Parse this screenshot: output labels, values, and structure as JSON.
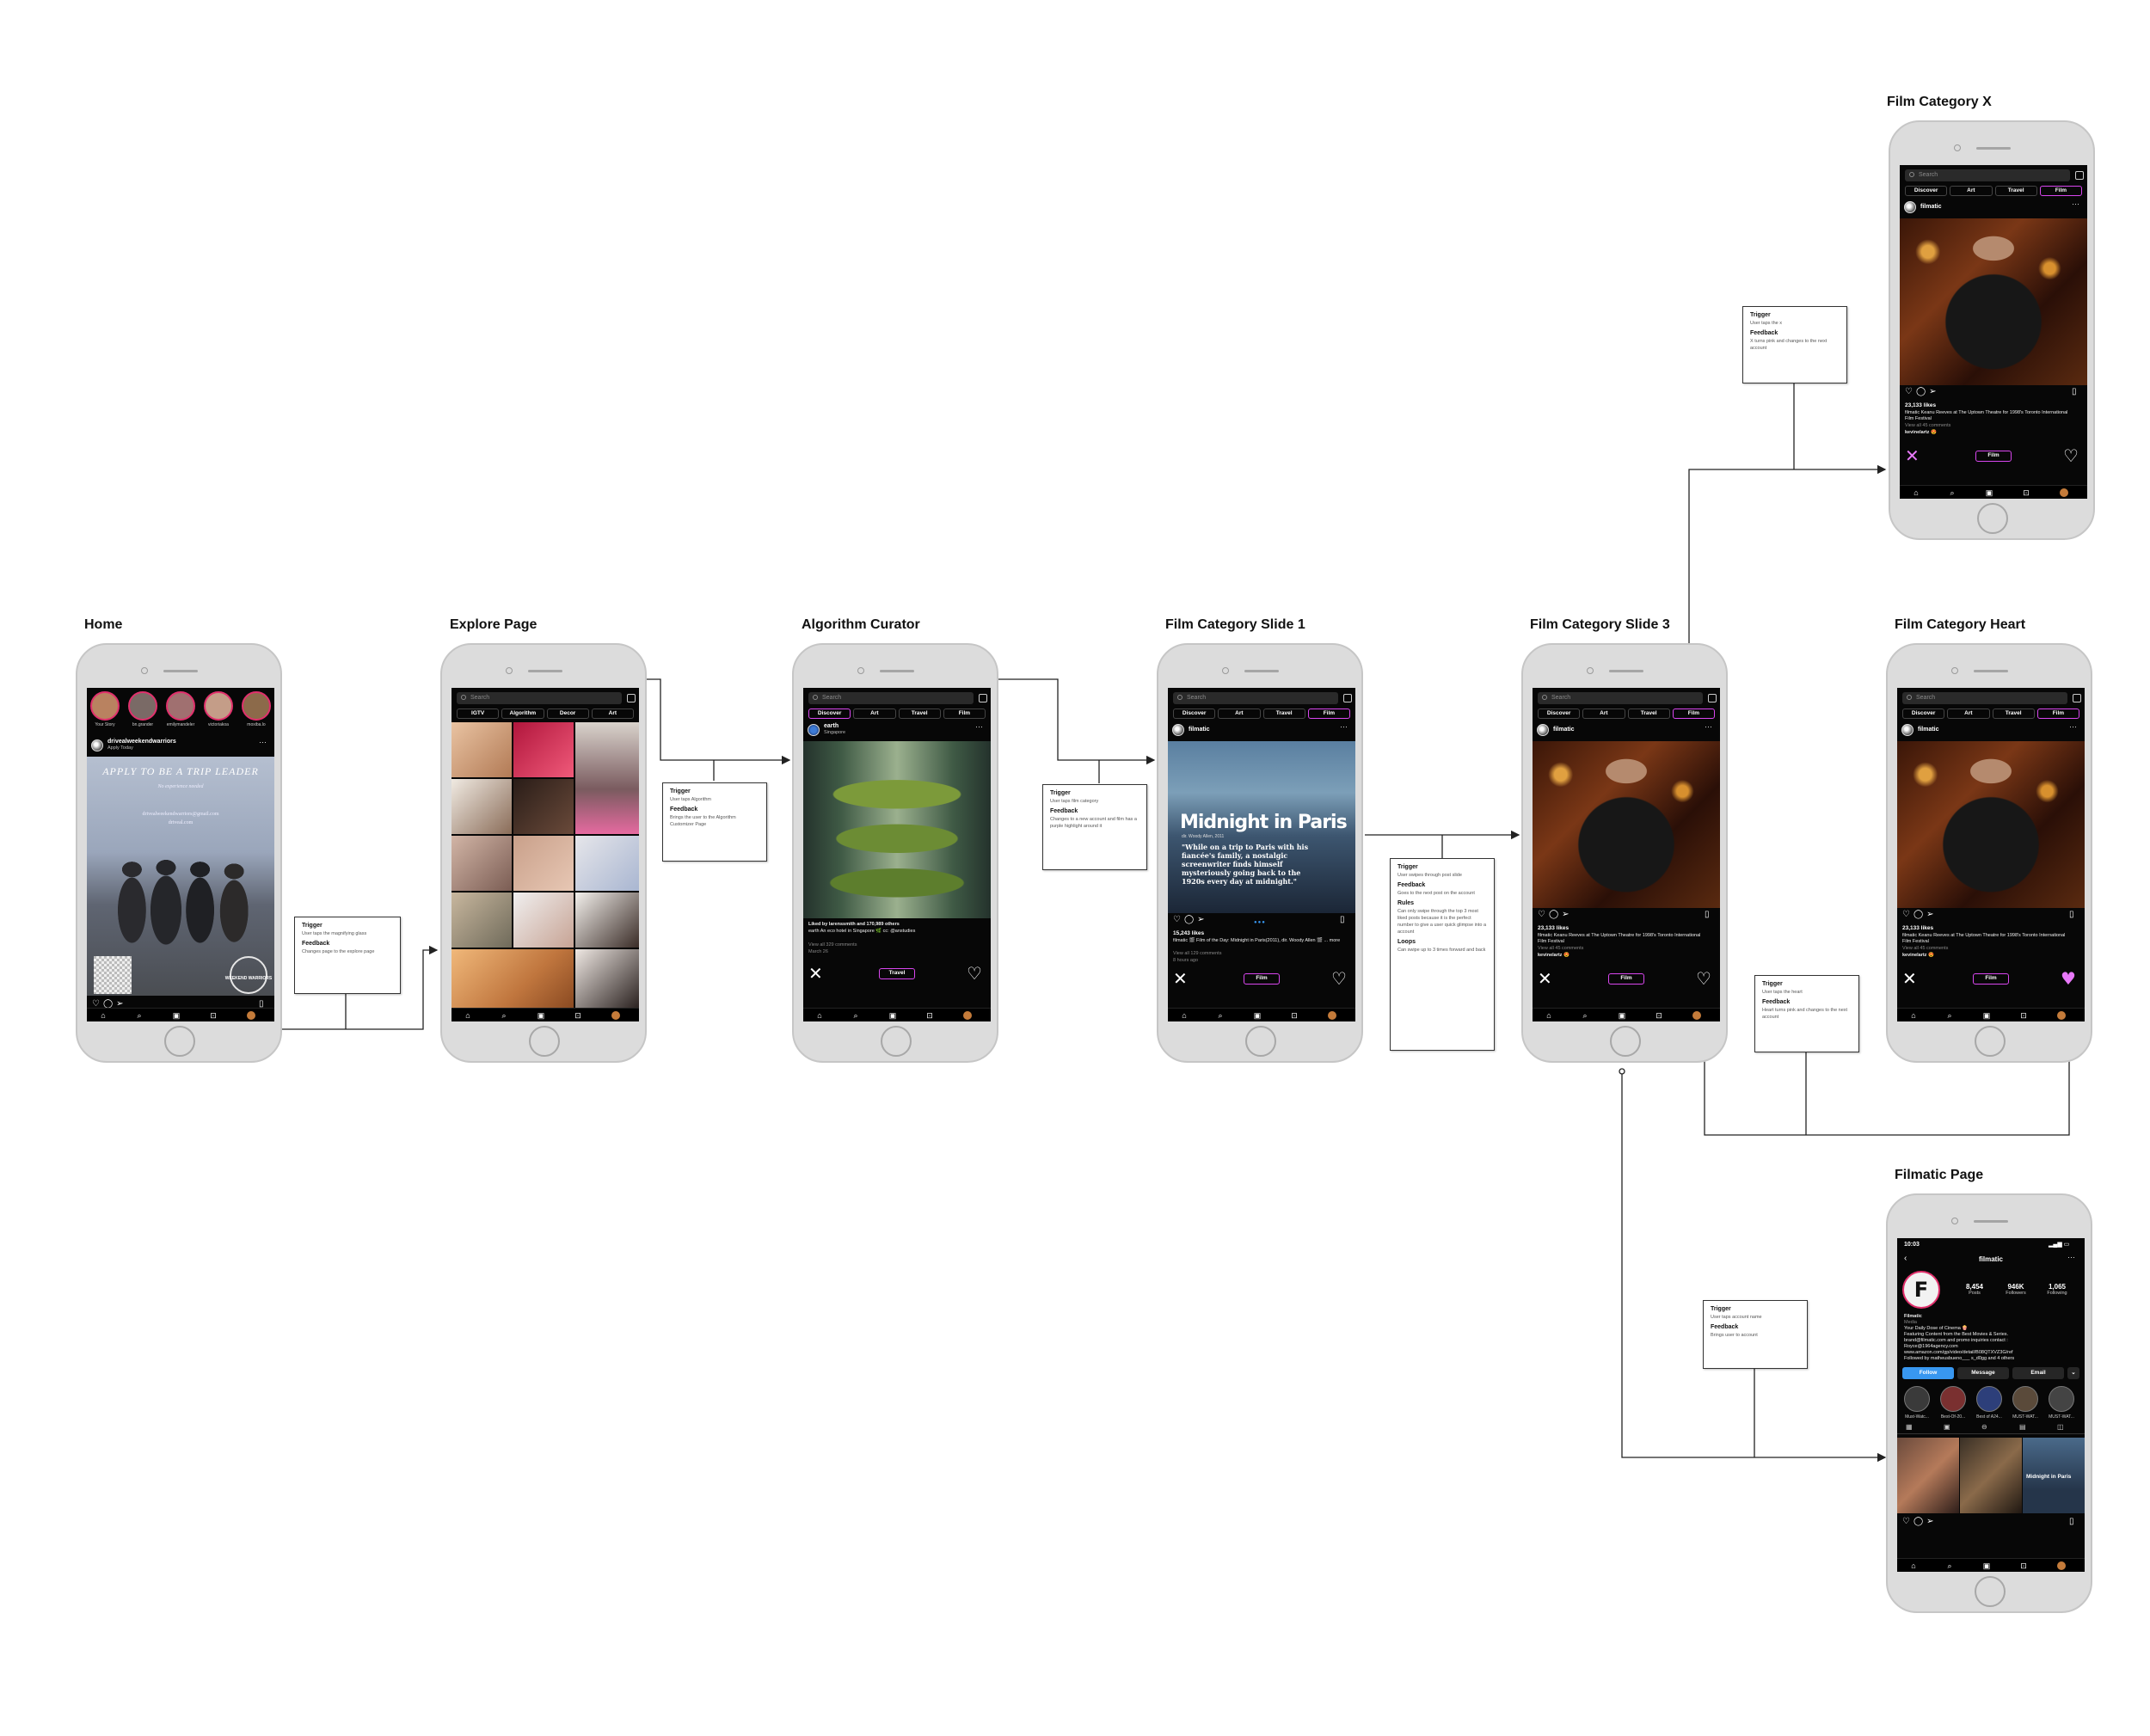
{
  "screens": {
    "home": {
      "title": "Home",
      "stories": [
        "Your Story",
        "bn.grander",
        "emilymandeler",
        "victoriakoa",
        "moxiba.lo"
      ],
      "account": "drivealweekendwarriors",
      "account_sub": "Apply Today",
      "poster_title": "APPLY TO BE A TRIP LEADER",
      "poster_line1": "No experience needed",
      "poster_line2": "drivealweekendwarriors@gmail.com",
      "poster_line3": "driveal.com",
      "badge": "WEEKEND WARRIORS"
    },
    "explore": {
      "title": "Explore Page",
      "search_placeholder": "Search",
      "tabs": [
        "IGTV",
        "Algorithm",
        "Decor",
        "Art"
      ]
    },
    "algorithm": {
      "title": "Algorithm Curator",
      "search_placeholder": "Search",
      "tabs": [
        "Discover",
        "Art",
        "Travel",
        "Film"
      ],
      "account": "earth",
      "account_sub": "Singapore",
      "caption": "Liked by larenssmith and 170,989 others",
      "caption2": "earth An eco hotel in Singapore 🌿 cc: @anstudies",
      "comments": "View all 329 comments",
      "date": "March 26",
      "category_label": "Travel"
    },
    "film_slide1": {
      "title": "Film Category Slide 1",
      "search_placeholder": "Search",
      "tabs": [
        "Discover",
        "Art",
        "Travel",
        "Film"
      ],
      "account": "filmatic",
      "poster_title": "Midnight in Paris",
      "poster_sub": "dir. Woody Allen, 2011",
      "poster_quote": "\"While on a trip to Paris with his fiancée's family, a nostalgic screenwriter finds himself mysteriously going back to the 1920s every day at midnight.\"",
      "likes": "15,243 likes",
      "caption": "filmatic 🎬 Film of the Day: Midnight in Paris(2011), dir. Woody Allen 🎬 ... more",
      "comments": "View all 129 comments",
      "time": "8 hours ago",
      "category_label": "Film"
    },
    "film_slide3": {
      "title": "Film Category Slide 3",
      "search_placeholder": "Search",
      "tabs": [
        "Discover",
        "Art",
        "Travel",
        "Film"
      ],
      "account": "filmatic",
      "likes": "23,133 likes",
      "caption": "filmatic Keanu Reeves at The Uptown Theatre for 1998's Toronto International Film Festival",
      "comments": "View all 45 comments",
      "commenter": "kevinelartz 😍",
      "category_label": "Film"
    },
    "film_x": {
      "title": "Film Category X",
      "search_placeholder": "Search",
      "tabs": [
        "Discover",
        "Art",
        "Travel",
        "Film"
      ],
      "account": "filmatic",
      "likes": "23,133 likes",
      "caption": "filmatic Keanu Reeves at The Uptown Theatre for 1998's Toronto International Film Festival",
      "comments": "View all 45 comments",
      "commenter": "kevinelartz 😍",
      "category_label": "Film"
    },
    "film_heart": {
      "title": "Film Category Heart",
      "search_placeholder": "Search",
      "tabs": [
        "Discover",
        "Art",
        "Travel",
        "Film"
      ],
      "account": "filmatic",
      "likes": "23,133 likes",
      "caption": "filmatic Keanu Reeves at The Uptown Theatre for 1998's Toronto International Film Festival",
      "comments": "View all 45 comments",
      "commenter": "kevinelartz 😍",
      "category_label": "Film"
    },
    "filmatic_page": {
      "title": "Filmatic Page",
      "status_time": "10:03",
      "username": "filmatic",
      "posts": "8,454",
      "posts_label": "Posts",
      "followers": "946K",
      "followers_label": "Followers",
      "following": "1,065",
      "following_label": "Following",
      "name": "Filmatic",
      "category": "Media",
      "bio": [
        "Your Daily Dose of Cinema 🍿",
        "Featuring Content from the Best Movies & Series.",
        "brand@filmatic.com and promo inquiries contact :",
        "Royce@1964agency.com",
        "www.amazon.com/gp/video/detail/B08QTXVZ3G/ref",
        "Followed by matheusbueno___ s_d0gg and 4 others"
      ],
      "follow_btn": "Follow",
      "message_btn": "Message",
      "email_btn": "Email",
      "highlights": [
        "Must-Watc...",
        "Best-Of-20...",
        "Best of A24...",
        "MUST-WAT...",
        "MUST-WAT..."
      ],
      "thumb_label": "Midnight in Paris"
    }
  },
  "annotations": [
    {
      "trigger": "Trigger",
      "trigger_text": "User taps the magnifying glass",
      "feedback": "Feedback",
      "feedback_text": "Changes page to the explore page"
    },
    {
      "trigger": "Trigger",
      "trigger_text": "User taps Algorithm",
      "feedback": "Feedback",
      "feedback_text": "Brings the user to the Algorithm Customizer Page"
    },
    {
      "trigger": "Trigger",
      "trigger_text": "User taps film category",
      "feedback": "Feedback",
      "feedback_text": "Changes to a new account and film has a purple highlight around it"
    },
    {
      "trigger": "Trigger",
      "trigger_text": "User swipes through post slide",
      "feedback": "Feedback",
      "feedback_text": "Goes to the next post on the account",
      "rules": "Rules",
      "rules_text": "Can only swipe through the top 3 most liked posts because it is the perfect number to give a user quick glimpse into a account",
      "loops": "Loops",
      "loops_text": "Can swipe up to 3 times forward and back"
    },
    {
      "trigger": "Trigger",
      "trigger_text": "User taps the x",
      "feedback": "Feedback",
      "feedback_text": "X turns pink and changes to the next account"
    },
    {
      "trigger": "Trigger",
      "trigger_text": "User taps the heart",
      "feedback": "Feedback",
      "feedback_text": "Heart turns pink and changes to the next account"
    },
    {
      "trigger": "Trigger",
      "trigger_text": "User taps account name",
      "feedback": "Feedback",
      "feedback_text": "Brings user to account"
    }
  ],
  "colors": {
    "accent": "#d946ef",
    "highlight_pink": "#e879f9",
    "follow_blue": "#3897f0",
    "phone_frame": "#dcdcdc",
    "screen_bg": "#070707"
  },
  "icons": [
    "search-icon",
    "scan-icon",
    "home-icon",
    "reels-icon",
    "shop-icon",
    "heart-icon",
    "comment-icon",
    "share-icon",
    "bookmark-icon",
    "x-icon"
  ]
}
